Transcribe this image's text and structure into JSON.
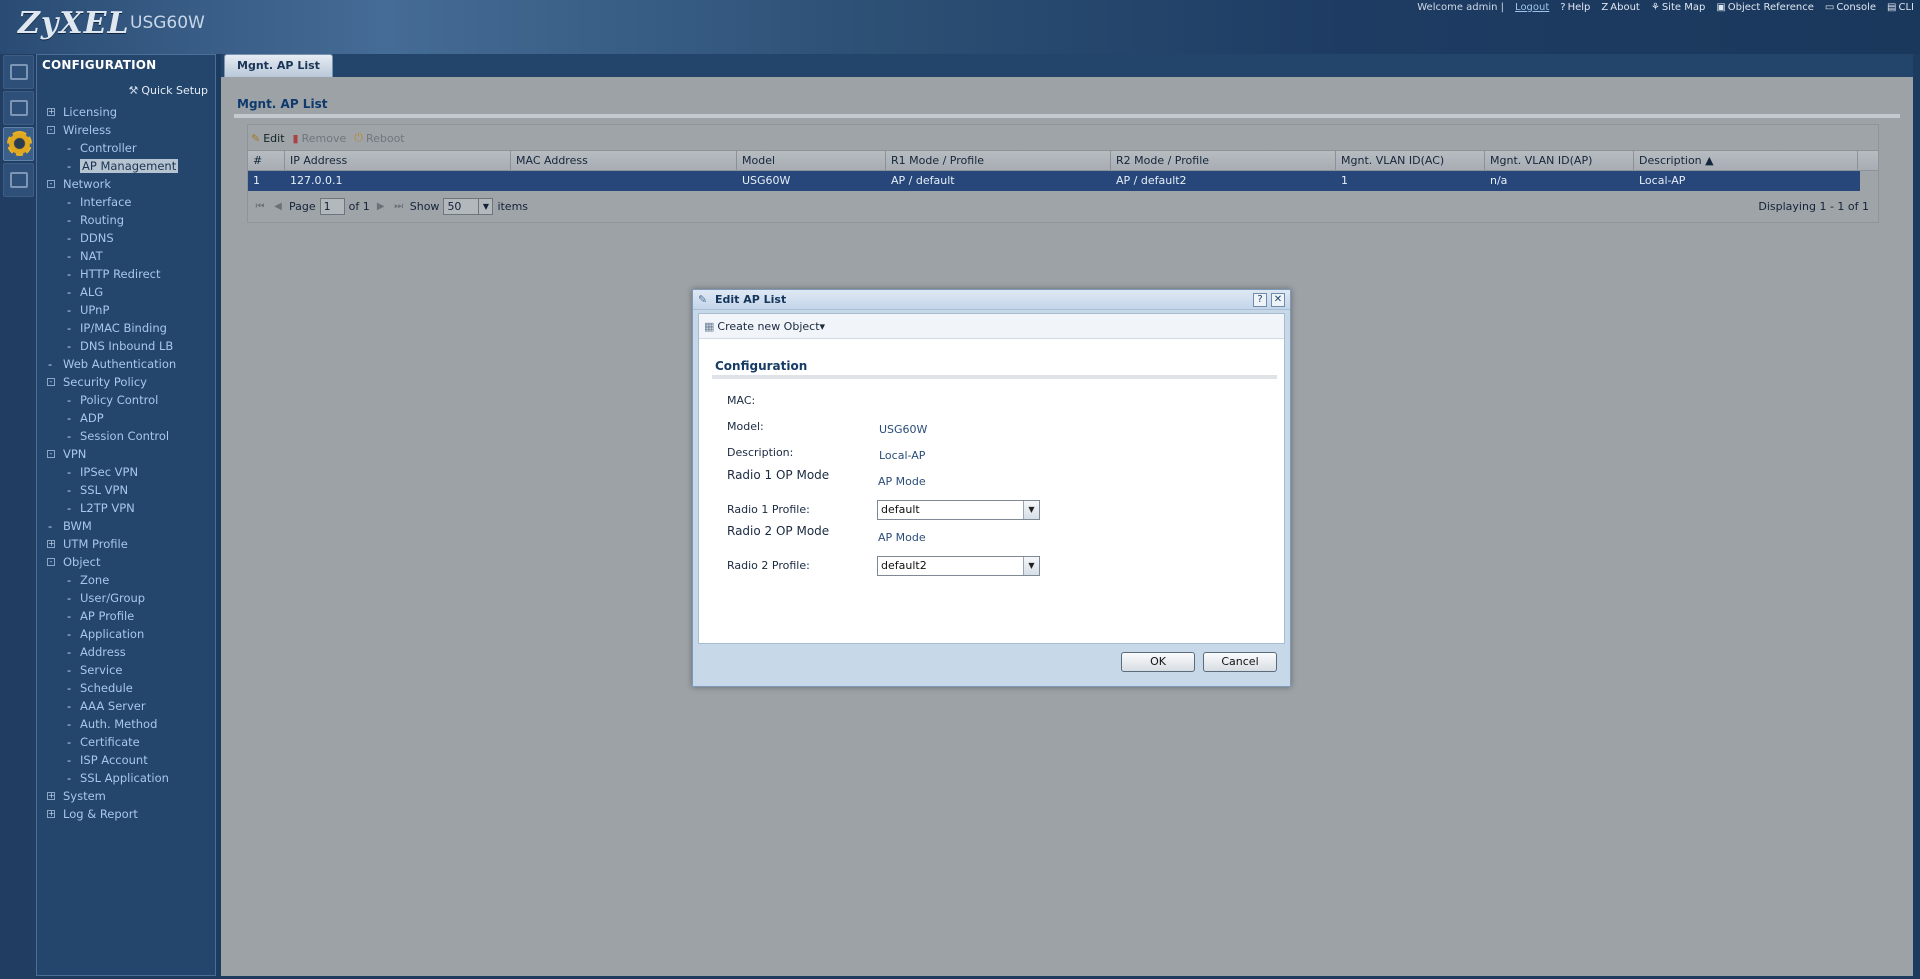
{
  "header": {
    "logo": "ZyXEL",
    "model": "USG60W",
    "welcome": "Welcome admin |",
    "logout": "Logout",
    "links": [
      "Help",
      "About",
      "Site Map",
      "Object Reference",
      "Console",
      "CLI"
    ],
    "link_icons": [
      "help-icon",
      "about-icon",
      "site-map-icon",
      "object-reference-icon",
      "console-icon",
      "cli-icon"
    ]
  },
  "iconbar": {
    "items": [
      "dashboard-icon",
      "monitor-icon",
      "configuration-icon",
      "maintenance-icon"
    ],
    "active_index": 2
  },
  "sidebar": {
    "title": "CONFIGURATION",
    "quick_setup": "Quick Setup",
    "items": [
      {
        "label": "Licensing",
        "level": 1,
        "marker": "+"
      },
      {
        "label": "Wireless",
        "level": 1,
        "marker": "-"
      },
      {
        "label": "Controller",
        "level": 2
      },
      {
        "label": "AP Management",
        "level": 2,
        "selected": true
      },
      {
        "label": "Network",
        "level": 1,
        "marker": "-"
      },
      {
        "label": "Interface",
        "level": 2
      },
      {
        "label": "Routing",
        "level": 2
      },
      {
        "label": "DDNS",
        "level": 2
      },
      {
        "label": "NAT",
        "level": 2
      },
      {
        "label": "HTTP Redirect",
        "level": 2
      },
      {
        "label": "ALG",
        "level": 2
      },
      {
        "label": "UPnP",
        "level": 2
      },
      {
        "label": "IP/MAC Binding",
        "level": 2
      },
      {
        "label": "DNS Inbound LB",
        "level": 2
      },
      {
        "label": "Web Authentication",
        "level": 1,
        "marker": "dash"
      },
      {
        "label": "Security Policy",
        "level": 1,
        "marker": "-"
      },
      {
        "label": "Policy Control",
        "level": 2
      },
      {
        "label": "ADP",
        "level": 2
      },
      {
        "label": "Session Control",
        "level": 2
      },
      {
        "label": "VPN",
        "level": 1,
        "marker": "-"
      },
      {
        "label": "IPSec VPN",
        "level": 2
      },
      {
        "label": "SSL VPN",
        "level": 2
      },
      {
        "label": "L2TP VPN",
        "level": 2
      },
      {
        "label": "BWM",
        "level": 1,
        "marker": "dash"
      },
      {
        "label": "UTM Profile",
        "level": 1,
        "marker": "+"
      },
      {
        "label": "Object",
        "level": 1,
        "marker": "-"
      },
      {
        "label": "Zone",
        "level": 2
      },
      {
        "label": "User/Group",
        "level": 2
      },
      {
        "label": "AP Profile",
        "level": 2
      },
      {
        "label": "Application",
        "level": 2
      },
      {
        "label": "Address",
        "level": 2
      },
      {
        "label": "Service",
        "level": 2
      },
      {
        "label": "Schedule",
        "level": 2
      },
      {
        "label": "AAA Server",
        "level": 2
      },
      {
        "label": "Auth. Method",
        "level": 2
      },
      {
        "label": "Certificate",
        "level": 2
      },
      {
        "label": "ISP Account",
        "level": 2
      },
      {
        "label": "SSL Application",
        "level": 2
      },
      {
        "label": "System",
        "level": 1,
        "marker": "+"
      },
      {
        "label": "Log & Report",
        "level": 1,
        "marker": "+"
      }
    ]
  },
  "main": {
    "tab": "Mgnt. AP List",
    "title": "Mgnt. AP List",
    "toolbar": {
      "edit": "Edit",
      "remove": "Remove",
      "reboot": "Reboot"
    },
    "columns": [
      "#",
      "IP Address",
      "MAC Address",
      "Model",
      "R1 Mode / Profile",
      "R2 Mode / Profile",
      "Mgnt. VLAN ID(AC)",
      "Mgnt. VLAN ID(AP)",
      "Description ▲"
    ],
    "rows": [
      [
        "1",
        "127.0.0.1",
        "",
        "USG60W",
        "AP / default",
        "AP / default2",
        "1",
        "n/a",
        "Local-AP"
      ]
    ],
    "pager": {
      "page_label": "Page",
      "page": "1",
      "of_label": "of 1",
      "show_label": "Show",
      "show": "50",
      "items_label": "items",
      "display": "Displaying 1 - 1 of 1"
    }
  },
  "dialog": {
    "title": "Edit AP List",
    "create_object": "Create new Object▾",
    "section": "Configuration",
    "mac_label": "MAC:",
    "mac_value": "",
    "model_label": "Model:",
    "model_value": "USG60W",
    "description_label": "Description:",
    "description_value": "Local-AP",
    "radio1_mode_label": "Radio 1 OP Mode",
    "radio1_mode_value": "AP Mode",
    "radio1_profile_label": "Radio 1 Profile:",
    "radio1_profile_value": "default",
    "radio2_mode_label": "Radio 2 OP Mode",
    "radio2_mode_value": "AP Mode",
    "radio2_profile_label": "Radio 2 Profile:",
    "radio2_profile_value": "default2",
    "ok": "OK",
    "cancel": "Cancel"
  }
}
